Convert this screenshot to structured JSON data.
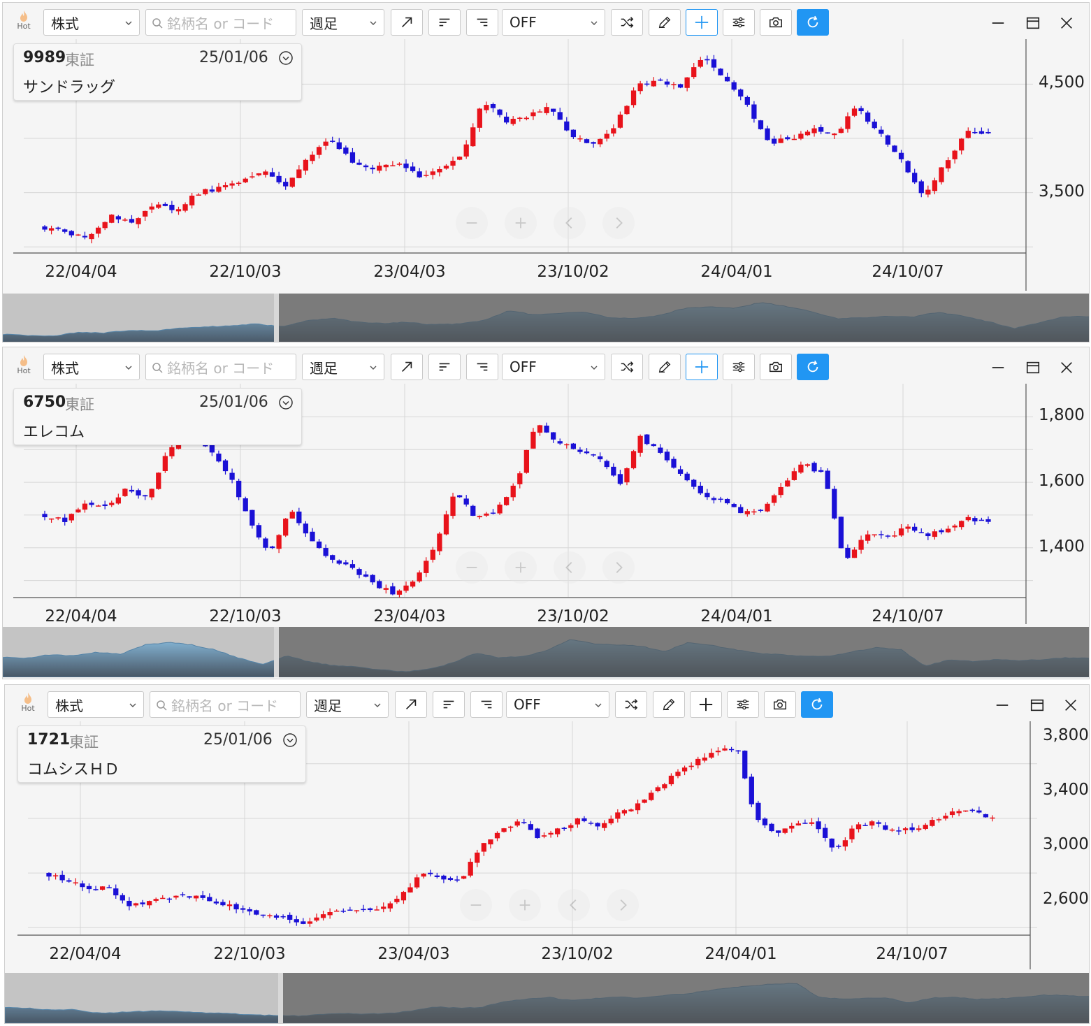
{
  "toolbar": {
    "hot_label": "Hot",
    "type_select": "株式",
    "search_placeholder": "銘柄名 or コード",
    "period_select": "週足",
    "indicator_select": "OFF"
  },
  "colors": {
    "up": "#e8131b",
    "down": "#1a10d6",
    "accent": "#2196f3",
    "grid": "#dadada"
  },
  "icons": [
    "flame-icon",
    "chevron-down-icon",
    "search-icon",
    "trend-line-icon",
    "align-left-icon",
    "align-right-icon",
    "shuffle-icon",
    "pencil-icon",
    "crosshair-icon",
    "sliders-icon",
    "camera-icon",
    "refresh-icon",
    "minimize-icon",
    "maximize-icon",
    "close-icon",
    "zoom-out-icon",
    "zoom-in-icon",
    "scroll-left-icon",
    "scroll-right-icon"
  ],
  "windows": [
    {
      "code": "9989",
      "exchange": "東証",
      "date": "25/01/06",
      "name": "サンドラッグ",
      "crosshair_active": true,
      "xticks": [
        "22/04/04",
        "22/10/03",
        "23/04/03",
        "23/10/02",
        "24/04/01",
        "24/10/07"
      ],
      "yticks": [
        "4,500",
        "3,500"
      ],
      "chart_data": {
        "type": "candlestick",
        "period": "weekly",
        "x_ticks": [
          "22/04/04",
          "22/10/03",
          "23/04/03",
          "23/10/02",
          "24/04/01",
          "24/10/07"
        ],
        "y_ticks": [
          3500,
          4500
        ],
        "y_range": [
          2950,
          4850
        ],
        "close_anchors": [
          3180,
          3130,
          3100,
          3280,
          3240,
          3380,
          3340,
          3500,
          3540,
          3600,
          3700,
          3560,
          3840,
          3980,
          3790,
          3720,
          3780,
          3650,
          3700,
          3860,
          4350,
          4150,
          4200,
          4300,
          4000,
          3960,
          4120,
          4480,
          4520,
          4480,
          4760,
          4550,
          4300,
          3960,
          4000,
          4080,
          4040,
          4280,
          4060,
          3800,
          3460,
          3760,
          4060,
          4060
        ]
      }
    },
    {
      "code": "6750",
      "exchange": "東証",
      "date": "25/01/06",
      "name": "エレコム",
      "crosshair_active": true,
      "xticks": [
        "22/04/04",
        "22/10/03",
        "23/04/03",
        "23/10/02",
        "24/04/01",
        "24/10/07"
      ],
      "yticks": [
        "1,800",
        "1,600",
        "1,400"
      ],
      "chart_data": {
        "type": "candlestick",
        "period": "weekly",
        "x_ticks": [
          "22/04/04",
          "22/10/03",
          "23/04/03",
          "23/10/02",
          "24/04/01",
          "24/10/07"
        ],
        "y_ticks": [
          1400,
          1600,
          1800
        ],
        "y_range": [
          1250,
          1880
        ],
        "close_anchors": [
          1500,
          1480,
          1540,
          1520,
          1580,
          1550,
          1700,
          1740,
          1700,
          1620,
          1480,
          1380,
          1520,
          1420,
          1360,
          1340,
          1290,
          1260,
          1300,
          1400,
          1570,
          1490,
          1510,
          1600,
          1790,
          1720,
          1700,
          1680,
          1590,
          1740,
          1690,
          1620,
          1560,
          1540,
          1510,
          1520,
          1590,
          1660,
          1620,
          1350,
          1450,
          1430,
          1460,
          1440,
          1460,
          1490,
          1480
        ]
      }
    },
    {
      "code": "1721",
      "exchange": "東証",
      "date": "25/01/06",
      "name": "コムシスＨＤ",
      "crosshair_active": false,
      "xticks": [
        "22/04/04",
        "22/10/03",
        "23/04/03",
        "23/10/02",
        "24/04/01",
        "24/10/07"
      ],
      "yticks": [
        "3,800",
        "3,400",
        "3,000",
        "2,600"
      ],
      "chart_data": {
        "type": "candlestick",
        "period": "weekly",
        "x_ticks": [
          "22/04/04",
          "22/10/03",
          "23/04/03",
          "23/10/02",
          "24/04/01",
          "24/10/07"
        ],
        "y_ticks": [
          2600,
          3400,
          3000,
          3800
        ],
        "y_range": [
          2350,
          3860
        ],
        "close_anchors": [
          2790,
          2750,
          2680,
          2700,
          2560,
          2580,
          2620,
          2640,
          2600,
          2560,
          2530,
          2480,
          2470,
          2440,
          2500,
          2530,
          2520,
          2550,
          2640,
          2800,
          2760,
          2760,
          3000,
          3100,
          3180,
          3050,
          3120,
          3200,
          3140,
          3240,
          3300,
          3420,
          3540,
          3620,
          3700,
          3720,
          3180,
          3100,
          3150,
          3160,
          2950,
          3150,
          3170,
          3100,
          3120,
          3180,
          3260,
          3250,
          3200
        ]
      }
    }
  ]
}
